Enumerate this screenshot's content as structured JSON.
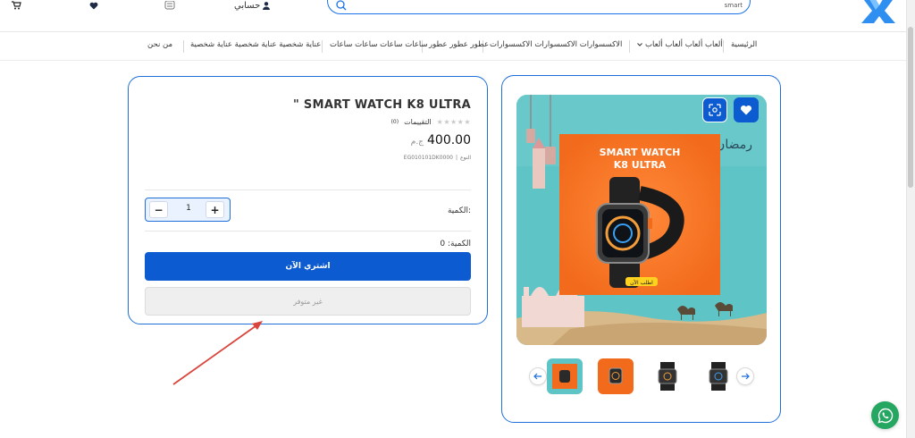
{
  "header": {
    "account_label": "حسابي",
    "search_value": "smart"
  },
  "nav": {
    "items": [
      {
        "label": "الرئيسية"
      },
      {
        "label": "ألعاب ألعاب ألعاب ألعاب"
      },
      {
        "label": "الاكسسوارات الاكسسوارات الاكسسوارات"
      },
      {
        "label": "عطور عطور عطور"
      },
      {
        "label": "ساعات ساعات ساعات ساعات"
      },
      {
        "label": "عناية شخصية عناية شخصية عناية شخصية"
      },
      {
        "label": "من نحن"
      }
    ]
  },
  "product": {
    "title": "\" SMART WATCH K8 ULTRA",
    "rating_label": "التقييمات",
    "rating_count": "(0)",
    "price": "400.00",
    "currency": "ج.م",
    "sku_label": "النوع",
    "sku_value": "EG010101DK0000",
    "quantity_label": "الكمية:",
    "quantity_value": "1",
    "available_qty_label": "الكمية: 0",
    "buy_now_label": "اشتري الآن",
    "unavailable_label": "غير متوفر"
  },
  "banner": {
    "line1": "SMART WATCH",
    "line2": "K8 ULTRA",
    "cta": "اطلب الآن",
    "greeting": "رمضان مبارك"
  },
  "colors": {
    "primary": "#0d5bd0",
    "border": "#1e6fd9",
    "banner_bg": "#5fc4c6",
    "banner_orange": "#f26a1b",
    "annotation_arrow": "#d9443c",
    "whatsapp": "#25a661"
  }
}
